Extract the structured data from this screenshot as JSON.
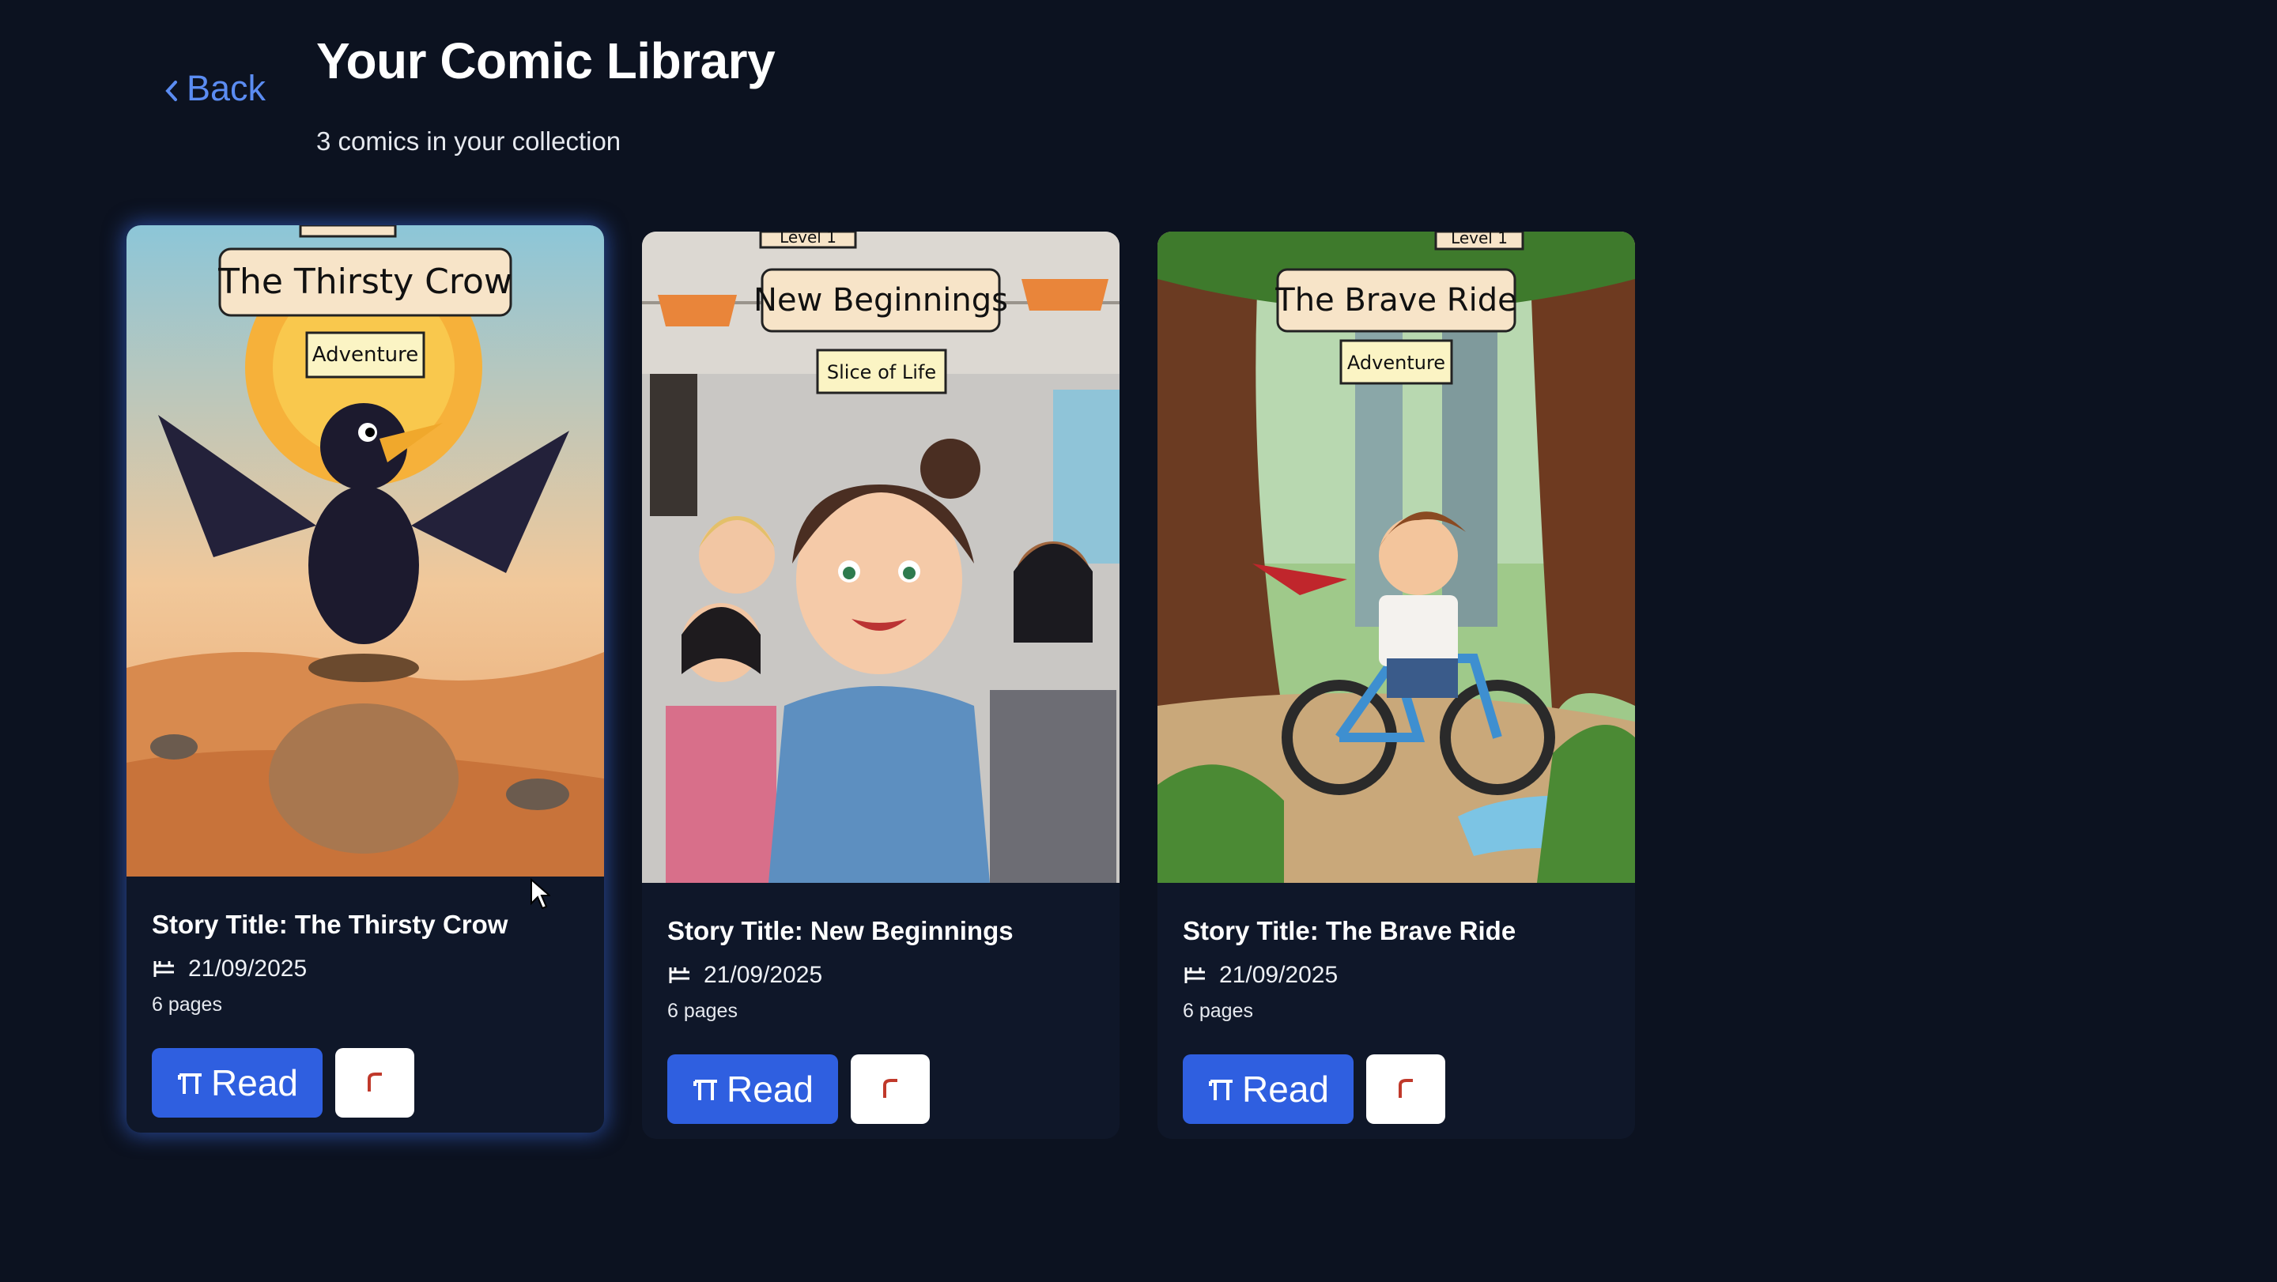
{
  "nav": {
    "back_label": "Back"
  },
  "header": {
    "title": "Your Comic Library",
    "subtitle": "3 comics in your collection"
  },
  "comics": [
    {
      "cover_title": "The Thirsty Crow",
      "cover_genre": "Adventure",
      "story_title": "Story Title: The Thirsty Crow",
      "date": "21/09/2025",
      "pages": "6 pages",
      "read_label": "Read"
    },
    {
      "cover_level": "Level 1",
      "cover_title": "New Beginnings",
      "cover_genre": "Slice of Life",
      "story_title": "Story Title: New Beginnings",
      "date": "21/09/2025",
      "pages": "6 pages",
      "read_label": "Read"
    },
    {
      "cover_level": "Level 1",
      "cover_title": "The Brave Ride",
      "cover_genre": "Adventure",
      "story_title": "Story Title: The Brave Ride",
      "date": "21/09/2025",
      "pages": "6 pages",
      "read_label": "Read"
    }
  ],
  "icons": {
    "back": "chevron-left-icon",
    "date": "calendar-icon",
    "read": "book-icon",
    "delete": "trash-icon"
  },
  "colors": {
    "background": "#0c1220",
    "card": "#0f1729",
    "accent": "#2f5fe0",
    "link": "#5b8cf2",
    "delete_icon": "#c0392b"
  }
}
